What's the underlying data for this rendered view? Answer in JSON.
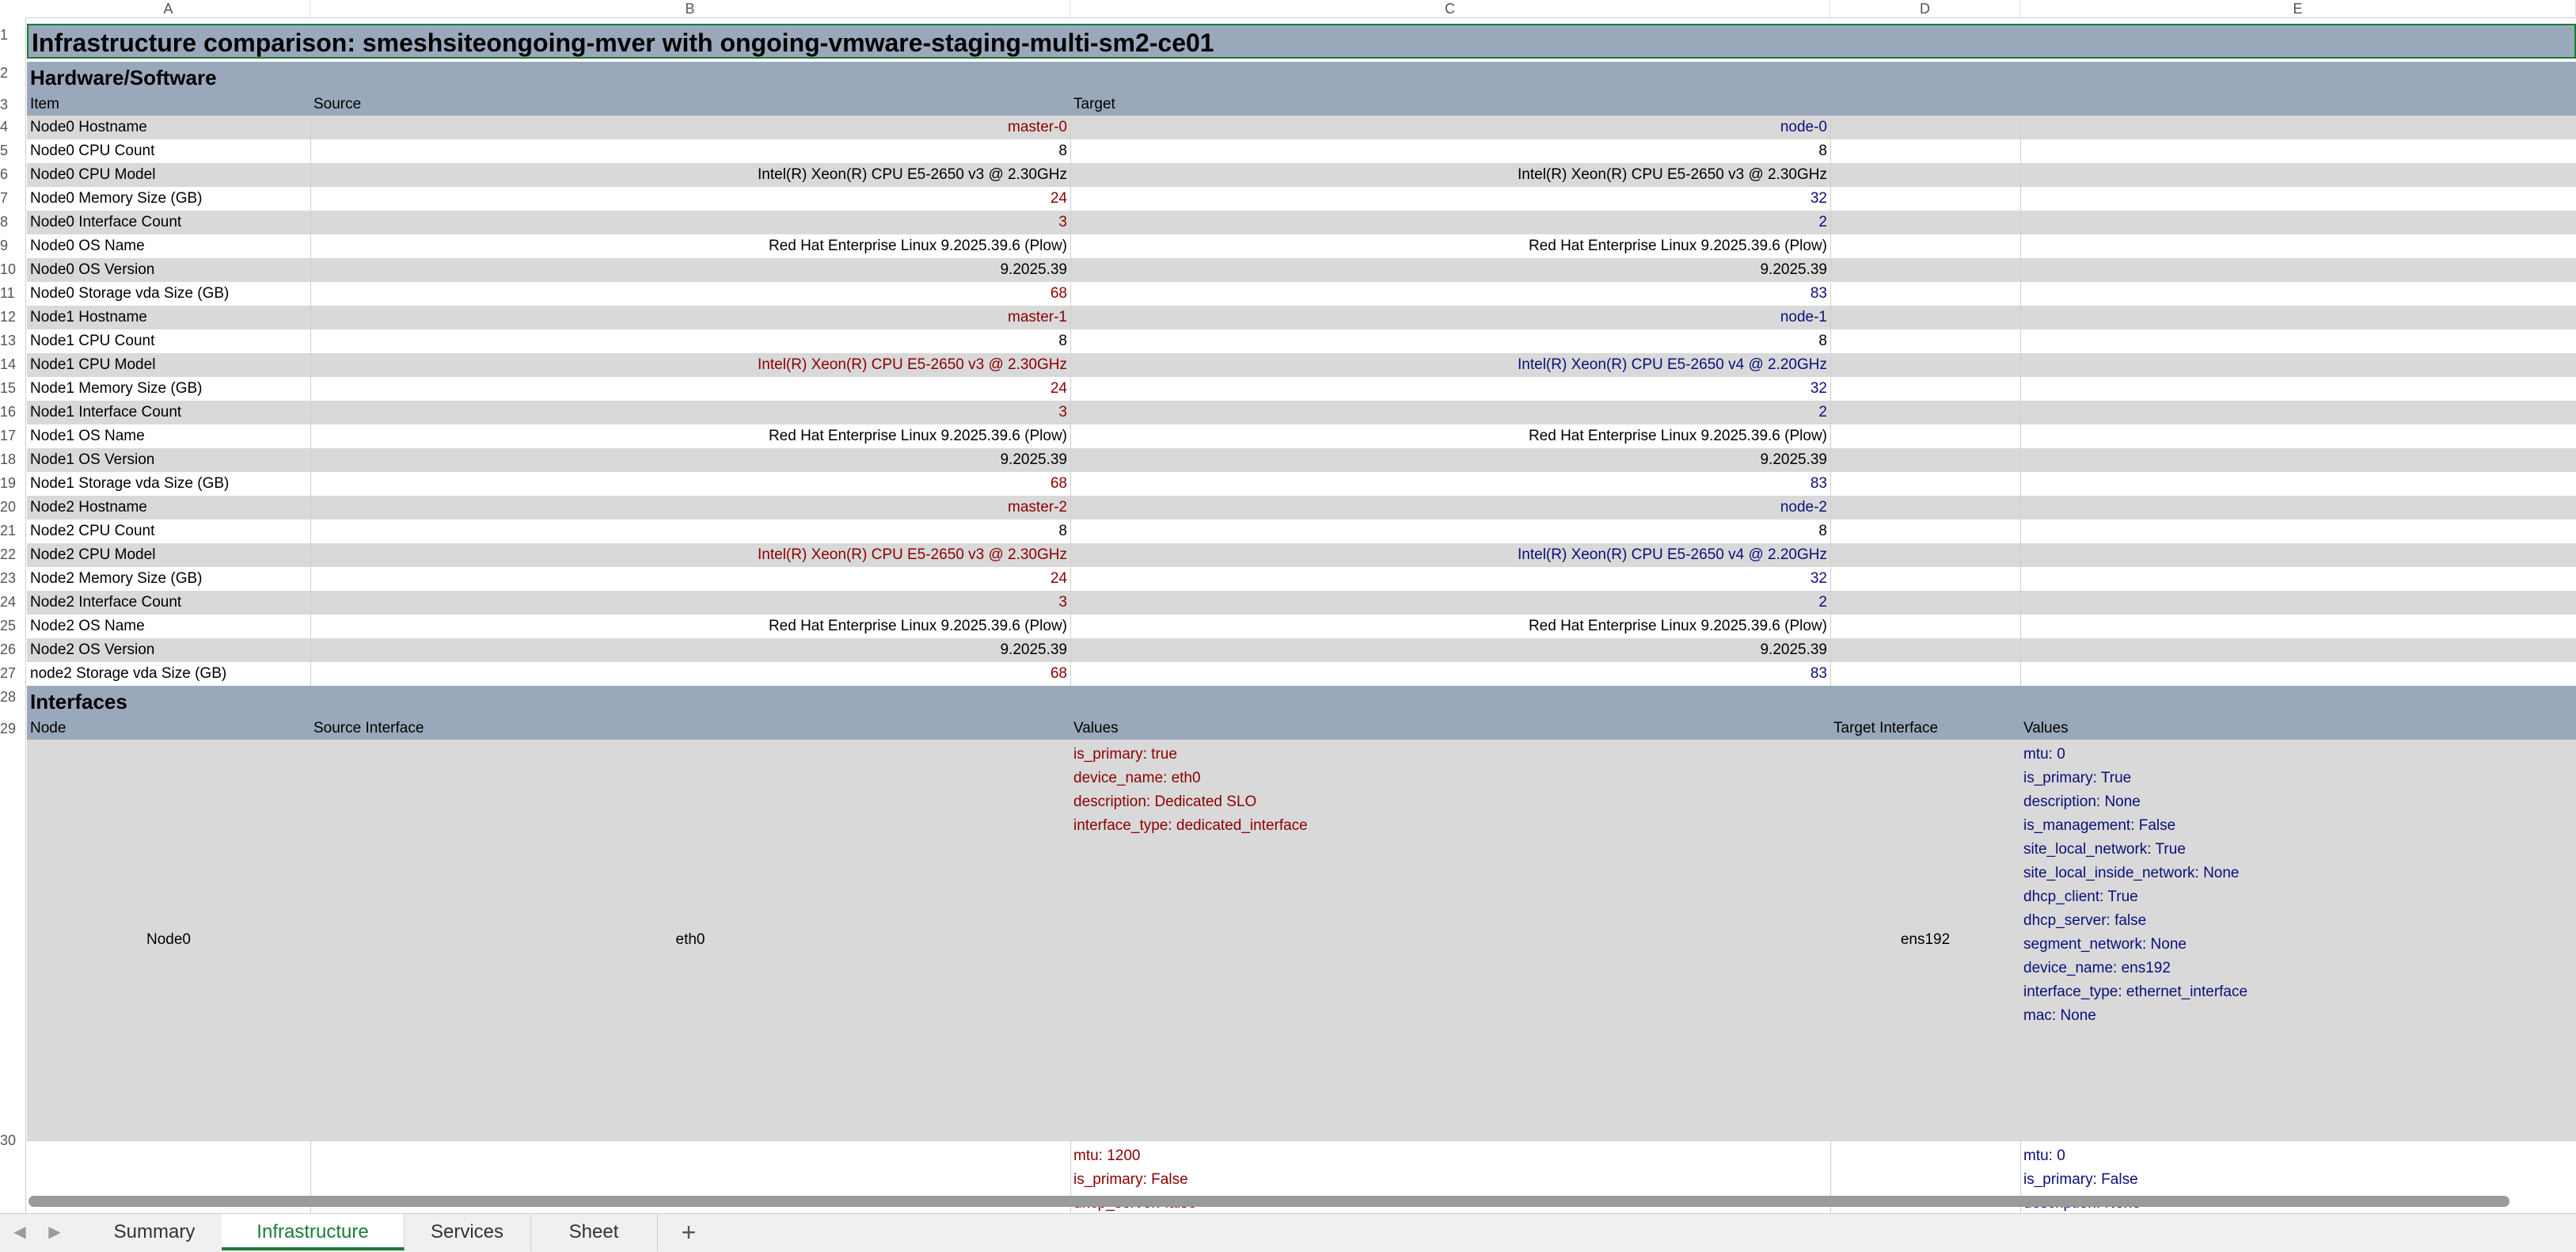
{
  "columns": [
    "A",
    "B",
    "C",
    "D",
    "E"
  ],
  "row_numbers": [
    "1",
    "2",
    "3",
    "4",
    "5",
    "6",
    "7",
    "8",
    "9",
    "10",
    "11",
    "12",
    "13",
    "14",
    "15",
    "16",
    "17",
    "18",
    "19",
    "20",
    "21",
    "22",
    "23",
    "24",
    "25",
    "26",
    "27",
    "28",
    "29",
    "30"
  ],
  "title": "Infrastructure comparison: smeshsiteongoing-mver with ongoing-vmware-staging-multi-sm2-ce01",
  "section_hw": "Hardware/Software",
  "hw_headers": {
    "item": "Item",
    "source": "Source",
    "target": "Target"
  },
  "hw_rows": [
    {
      "item": "Node0 Hostname",
      "source": "master-0",
      "target": "node-0",
      "diff": true
    },
    {
      "item": "Node0 CPU Count",
      "source": "8",
      "target": "8",
      "diff": false
    },
    {
      "item": "Node0 CPU Model",
      "source": "Intel(R) Xeon(R) CPU E5-2650 v3 @ 2.30GHz",
      "target": "Intel(R) Xeon(R) CPU E5-2650 v3 @ 2.30GHz",
      "diff": false
    },
    {
      "item": "Node0 Memory Size (GB)",
      "source": "24",
      "target": "32",
      "diff": true
    },
    {
      "item": "Node0 Interface Count",
      "source": "3",
      "target": "2",
      "diff": true
    },
    {
      "item": "Node0 OS Name",
      "source": "Red Hat Enterprise Linux 9.2025.39.6 (Plow)",
      "target": "Red Hat Enterprise Linux 9.2025.39.6 (Plow)",
      "diff": false
    },
    {
      "item": "Node0 OS Version",
      "source": "9.2025.39",
      "target": "9.2025.39",
      "diff": false
    },
    {
      "item": "Node0 Storage vda Size (GB)",
      "source": "68",
      "target": "83",
      "diff": true
    },
    {
      "item": "Node1 Hostname",
      "source": "master-1",
      "target": "node-1",
      "diff": true
    },
    {
      "item": "Node1 CPU Count",
      "source": "8",
      "target": "8",
      "diff": false
    },
    {
      "item": "Node1 CPU Model",
      "source": "Intel(R) Xeon(R) CPU E5-2650 v3 @ 2.30GHz",
      "target": "Intel(R) Xeon(R) CPU E5-2650 v4 @ 2.20GHz",
      "diff": true
    },
    {
      "item": "Node1 Memory Size (GB)",
      "source": "24",
      "target": "32",
      "diff": true
    },
    {
      "item": "Node1 Interface Count",
      "source": "3",
      "target": "2",
      "diff": true
    },
    {
      "item": "Node1 OS Name",
      "source": "Red Hat Enterprise Linux 9.2025.39.6 (Plow)",
      "target": "Red Hat Enterprise Linux 9.2025.39.6 (Plow)",
      "diff": false
    },
    {
      "item": "Node1 OS Version",
      "source": "9.2025.39",
      "target": "9.2025.39",
      "diff": false
    },
    {
      "item": "Node1 Storage vda Size (GB)",
      "source": "68",
      "target": "83",
      "diff": true
    },
    {
      "item": "Node2 Hostname",
      "source": "master-2",
      "target": "node-2",
      "diff": true
    },
    {
      "item": "Node2 CPU Count",
      "source": "8",
      "target": "8",
      "diff": false
    },
    {
      "item": "Node2 CPU Model",
      "source": "Intel(R) Xeon(R) CPU E5-2650 v3 @ 2.30GHz",
      "target": "Intel(R) Xeon(R) CPU E5-2650 v4 @ 2.20GHz",
      "diff": true
    },
    {
      "item": "Node2 Memory Size (GB)",
      "source": "24",
      "target": "32",
      "diff": true
    },
    {
      "item": "Node2 Interface Count",
      "source": "3",
      "target": "2",
      "diff": true
    },
    {
      "item": "Node2 OS Name",
      "source": "Red Hat Enterprise Linux 9.2025.39.6 (Plow)",
      "target": "Red Hat Enterprise Linux 9.2025.39.6 (Plow)",
      "diff": false
    },
    {
      "item": "Node2 OS Version",
      "source": "9.2025.39",
      "target": "9.2025.39",
      "diff": false
    },
    {
      "item": "node2 Storage vda Size (GB)",
      "source": "68",
      "target": "83",
      "diff": true
    }
  ],
  "section_if": "Interfaces",
  "if_headers": {
    "node": "Node",
    "source_interface": "Source Interface",
    "values": "Values",
    "target_interface": "Target Interface",
    "values2": "Values"
  },
  "if_row1": {
    "node": "Node0",
    "source_interface": "eth0",
    "source_values": [
      "is_primary: true",
      "device_name: eth0",
      "description: Dedicated SLO",
      "interface_type: dedicated_interface"
    ],
    "target_interface": "ens192",
    "target_values": [
      "mtu: 0",
      "is_primary: True",
      "description: None",
      "is_management: False",
      "site_local_network: True",
      "site_local_inside_network: None",
      "dhcp_client: True",
      "dhcp_server: false",
      "segment_network: None",
      "device_name: ens192",
      "interface_type: ethernet_interface",
      "mac: None"
    ]
  },
  "if_row2": {
    "source_values": [
      "mtu: 1200",
      "is_primary: False",
      "dhcp_server: false"
    ],
    "target_values": [
      "mtu: 0",
      "is_primary: False",
      "description: None"
    ]
  },
  "tabs": [
    {
      "label": "Summary",
      "active": false
    },
    {
      "label": "Infrastructure",
      "active": true
    },
    {
      "label": "Services",
      "active": false
    },
    {
      "label": "Sheet",
      "active": false
    }
  ],
  "add_tab": "+",
  "nav": {
    "prev": "◀",
    "next": "▶"
  },
  "colors": {
    "source_diff": "#8b0000",
    "target_diff": "#0a0f7a",
    "header_bg": "#9aa8bb",
    "active_tab": "#1d7a3a"
  }
}
